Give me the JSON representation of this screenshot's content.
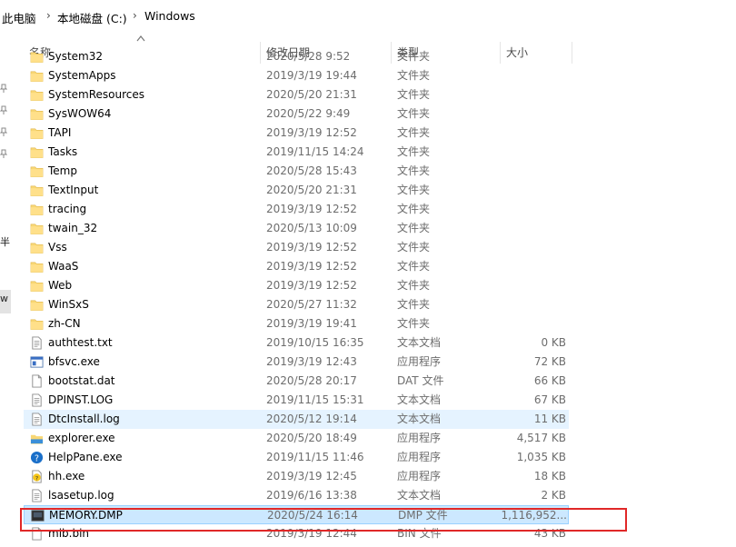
{
  "breadcrumb": {
    "items": [
      "此电脑",
      "本地磁盘 (C:)",
      "Windows"
    ],
    "separator": "›"
  },
  "columns": {
    "name": "名称",
    "date": "修改日期",
    "type": "类型",
    "size": "大小"
  },
  "nav_fragments": [
    "半",
    "w"
  ],
  "files": [
    {
      "name": "System32",
      "date": "2020/5/28 9:52",
      "type": "文件夹",
      "size": "",
      "icon": "folder-icon"
    },
    {
      "name": "SystemApps",
      "date": "2019/3/19 19:44",
      "type": "文件夹",
      "size": "",
      "icon": "folder-icon"
    },
    {
      "name": "SystemResources",
      "date": "2020/5/20 21:31",
      "type": "文件夹",
      "size": "",
      "icon": "folder-icon"
    },
    {
      "name": "SysWOW64",
      "date": "2020/5/22 9:49",
      "type": "文件夹",
      "size": "",
      "icon": "folder-icon"
    },
    {
      "name": "TAPI",
      "date": "2019/3/19 12:52",
      "type": "文件夹",
      "size": "",
      "icon": "folder-icon"
    },
    {
      "name": "Tasks",
      "date": "2019/11/15 14:24",
      "type": "文件夹",
      "size": "",
      "icon": "folder-icon"
    },
    {
      "name": "Temp",
      "date": "2020/5/28 15:43",
      "type": "文件夹",
      "size": "",
      "icon": "folder-icon"
    },
    {
      "name": "TextInput",
      "date": "2020/5/20 21:31",
      "type": "文件夹",
      "size": "",
      "icon": "folder-icon"
    },
    {
      "name": "tracing",
      "date": "2019/3/19 12:52",
      "type": "文件夹",
      "size": "",
      "icon": "folder-icon"
    },
    {
      "name": "twain_32",
      "date": "2020/5/13 10:09",
      "type": "文件夹",
      "size": "",
      "icon": "folder-icon"
    },
    {
      "name": "Vss",
      "date": "2019/3/19 12:52",
      "type": "文件夹",
      "size": "",
      "icon": "folder-icon"
    },
    {
      "name": "WaaS",
      "date": "2019/3/19 12:52",
      "type": "文件夹",
      "size": "",
      "icon": "folder-icon"
    },
    {
      "name": "Web",
      "date": "2019/3/19 12:52",
      "type": "文件夹",
      "size": "",
      "icon": "folder-icon"
    },
    {
      "name": "WinSxS",
      "date": "2020/5/27 11:32",
      "type": "文件夹",
      "size": "",
      "icon": "folder-icon"
    },
    {
      "name": "zh-CN",
      "date": "2019/3/19 19:41",
      "type": "文件夹",
      "size": "",
      "icon": "folder-icon"
    },
    {
      "name": "authtest.txt",
      "date": "2019/10/15 16:35",
      "type": "文本文档",
      "size": "0 KB",
      "icon": "text-file-icon"
    },
    {
      "name": "bfsvc.exe",
      "date": "2019/3/19 12:43",
      "type": "应用程序",
      "size": "72 KB",
      "icon": "exe-icon"
    },
    {
      "name": "bootstat.dat",
      "date": "2020/5/28 20:17",
      "type": "DAT 文件",
      "size": "66 KB",
      "icon": "blank-file-icon"
    },
    {
      "name": "DPINST.LOG",
      "date": "2019/11/15 15:31",
      "type": "文本文档",
      "size": "67 KB",
      "icon": "text-file-icon"
    },
    {
      "name": "DtcInstall.log",
      "date": "2020/5/12 19:14",
      "type": "文本文档",
      "size": "11 KB",
      "icon": "text-file-icon",
      "state": "hover"
    },
    {
      "name": "explorer.exe",
      "date": "2020/5/20 18:49",
      "type": "应用程序",
      "size": "4,517 KB",
      "icon": "explorer-icon"
    },
    {
      "name": "HelpPane.exe",
      "date": "2019/11/15 11:46",
      "type": "应用程序",
      "size": "1,035 KB",
      "icon": "help-icon"
    },
    {
      "name": "hh.exe",
      "date": "2019/3/19 12:45",
      "type": "应用程序",
      "size": "18 KB",
      "icon": "hh-icon"
    },
    {
      "name": "lsasetup.log",
      "date": "2019/6/16 13:38",
      "type": "文本文档",
      "size": "2 KB",
      "icon": "text-file-icon"
    },
    {
      "name": "MEMORY.DMP",
      "date": "2020/5/24 16:14",
      "type": "DMP 文件",
      "size": "1,116,952...",
      "icon": "dmp-icon",
      "state": "selected"
    },
    {
      "name": "mib.bin",
      "date": "2019/3/19 12:44",
      "type": "BIN 文件",
      "size": "43 KB",
      "icon": "blank-file-icon"
    }
  ]
}
